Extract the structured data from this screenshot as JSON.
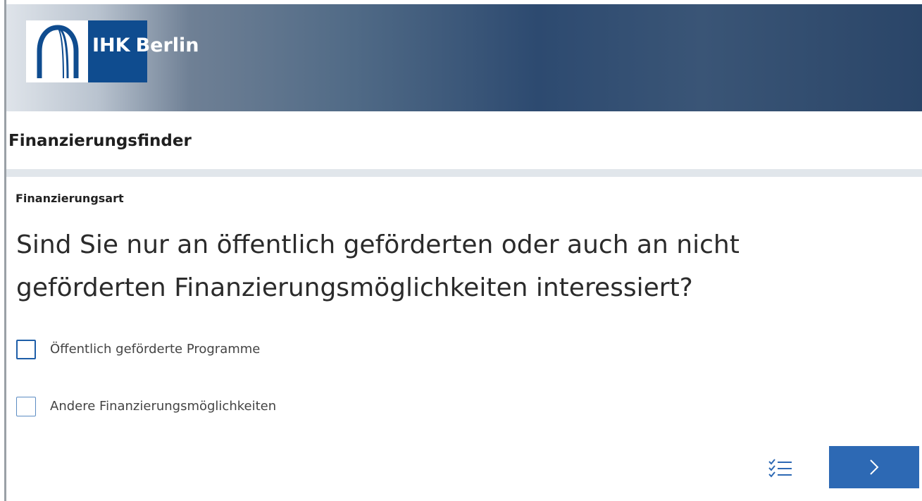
{
  "header": {
    "logo": {
      "brand": "IHK",
      "city": "Berlin"
    }
  },
  "page": {
    "title": "Finanzierungsfinder"
  },
  "form": {
    "section_label": "Finanzierungsart",
    "question": "Sind Sie nur an öffentlich geförderten oder auch an nicht geförderten Finanzierungsmöglichkeiten interessiert?",
    "options": [
      {
        "label": "Öffentlich geförderte Programme",
        "checked": false
      },
      {
        "label": "Andere Finanzierungsmöglichkeiten",
        "checked": false
      }
    ]
  },
  "footer": {
    "summary_icon": "checklist-icon",
    "next_icon": "chevron-right-icon"
  },
  "colors": {
    "brand_blue": "#0f4c8f",
    "button_blue": "#2d69b4",
    "checkbox_border": "#1e5ea8"
  }
}
